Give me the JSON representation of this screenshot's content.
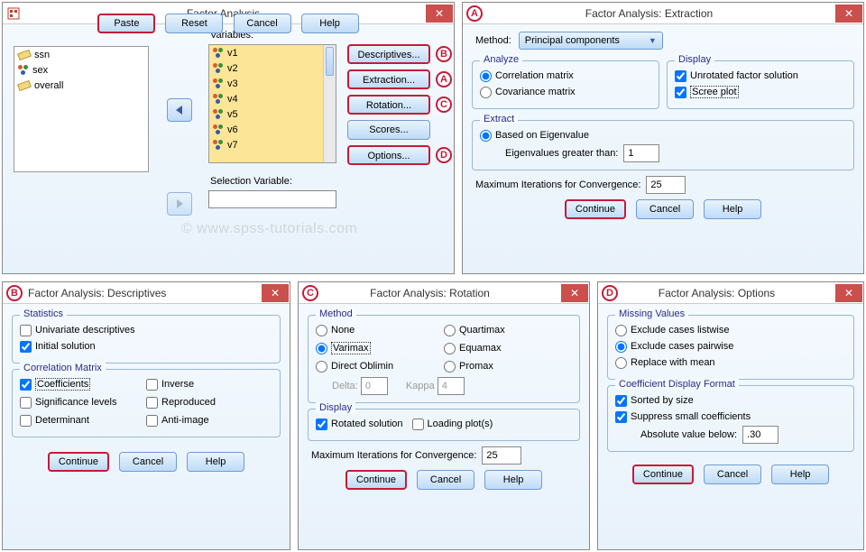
{
  "main": {
    "title": "Factor Analysis",
    "label_variables": "Variables:",
    "label_selection": "Selection Variable:",
    "left_items": [
      "ssn",
      "sex",
      "overall"
    ],
    "vars": [
      "v1",
      "v2",
      "v3",
      "v4",
      "v5",
      "v6",
      "v7"
    ],
    "side": {
      "descriptives": "Descriptives...",
      "extraction": "Extraction...",
      "rotation": "Rotation...",
      "scores": "Scores...",
      "options": "Options..."
    },
    "side_badges": {
      "descriptives": "B",
      "extraction": "A",
      "rotation": "C",
      "options": "D"
    },
    "buttons": {
      "paste": "Paste",
      "reset": "Reset",
      "cancel": "Cancel",
      "help": "Help"
    },
    "watermark": "© www.spss-tutorials.com"
  },
  "extraction": {
    "badge": "A",
    "title": "Factor Analysis: Extraction",
    "label_method": "Method:",
    "method_value": "Principal components",
    "grp_analyze": "Analyze",
    "opt_corr": "Correlation matrix",
    "opt_cov": "Covariance matrix",
    "grp_display": "Display",
    "opt_unrot": "Unrotated factor solution",
    "opt_scree": "Scree plot",
    "grp_extract": "Extract",
    "opt_eig": "Based on Eigenvalue",
    "label_eig_gt": "Eigenvalues greater than:",
    "val_eig": "1",
    "label_maxit": "Maximum Iterations for Convergence:",
    "val_maxit": "25",
    "buttons": {
      "continue": "Continue",
      "cancel": "Cancel",
      "help": "Help"
    }
  },
  "descriptives": {
    "badge": "B",
    "title": "Factor Analysis: Descriptives",
    "grp_stats": "Statistics",
    "opt_univ": "Univariate descriptives",
    "opt_init": "Initial solution",
    "grp_corr": "Correlation Matrix",
    "opt_coef": "Coefficients",
    "opt_inv": "Inverse",
    "opt_sig": "Significance levels",
    "opt_rep": "Reproduced",
    "opt_det": "Determinant",
    "opt_anti": "Anti-image",
    "buttons": {
      "continue": "Continue",
      "cancel": "Cancel",
      "help": "Help"
    }
  },
  "rotation": {
    "badge": "C",
    "title": "Factor Analysis: Rotation",
    "grp_method": "Method",
    "opts": {
      "none": "None",
      "varimax": "Varimax",
      "oblimin": "Direct Oblimin",
      "quart": "Quartimax",
      "equa": "Equamax",
      "promax": "Promax"
    },
    "label_delta": "Delta:",
    "val_delta": "0",
    "label_kappa": "Kappa",
    "val_kappa": "4",
    "grp_display": "Display",
    "opt_rotsol": "Rotated solution",
    "opt_loadplot": "Loading plot(s)",
    "label_maxit": "Maximum Iterations for Convergence:",
    "val_maxit": "25",
    "buttons": {
      "continue": "Continue",
      "cancel": "Cancel",
      "help": "Help"
    }
  },
  "options": {
    "badge": "D",
    "title": "Factor Analysis: Options",
    "grp_missing": "Missing Values",
    "opt_listwise": "Exclude cases listwise",
    "opt_pairwise": "Exclude cases pairwise",
    "opt_replace": "Replace with mean",
    "grp_coef": "Coefficient Display Format",
    "opt_sorted": "Sorted by size",
    "opt_suppress": "Suppress small coefficients",
    "label_abs": "Absolute value below:",
    "val_abs": ".30",
    "buttons": {
      "continue": "Continue",
      "cancel": "Cancel",
      "help": "Help"
    }
  }
}
